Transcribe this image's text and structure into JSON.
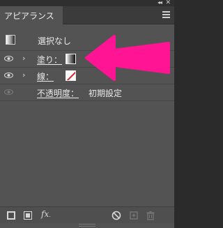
{
  "window": {
    "collapse_icon": "double-chevron-left-icon",
    "close_icon": "close-x-icon"
  },
  "tab": {
    "title": "アピアランス",
    "menu_icon": "hamburger-menu-icon"
  },
  "selection": {
    "label": "選択なし"
  },
  "attributes": [
    {
      "id": "fill",
      "label": "塗り：",
      "visible": true,
      "expandable": true,
      "swatch": "gradient"
    },
    {
      "id": "stroke",
      "label": "線：",
      "visible": true,
      "expandable": true,
      "swatch": "none"
    },
    {
      "id": "opacity",
      "label": "不透明度：",
      "value": "初期設定",
      "visible": false,
      "expandable": false
    }
  ],
  "annotation": {
    "arrow_color": "#ff1493",
    "target": "fill-swatch"
  },
  "footer": {
    "buttons": [
      {
        "name": "add-new-stroke-button",
        "icon": "square-outline-icon",
        "enabled": true
      },
      {
        "name": "add-new-fill-button",
        "icon": "filled-square-icon",
        "enabled": true
      },
      {
        "name": "add-new-effect-button",
        "label": "fx.",
        "enabled": true
      },
      {
        "name": "clear-appearance-button",
        "icon": "no-entry-icon",
        "enabled": true
      },
      {
        "name": "duplicate-item-button",
        "icon": "duplicate-icon",
        "enabled": false
      },
      {
        "name": "delete-item-button",
        "icon": "trash-icon",
        "enabled": false
      }
    ]
  },
  "colors": {
    "panel_bg": "#535353",
    "tab_bar_bg": "#3b3b3b",
    "text": "#eaeaea",
    "accent_arrow": "#ff1493",
    "stroke_none_red": "#e0202a"
  }
}
